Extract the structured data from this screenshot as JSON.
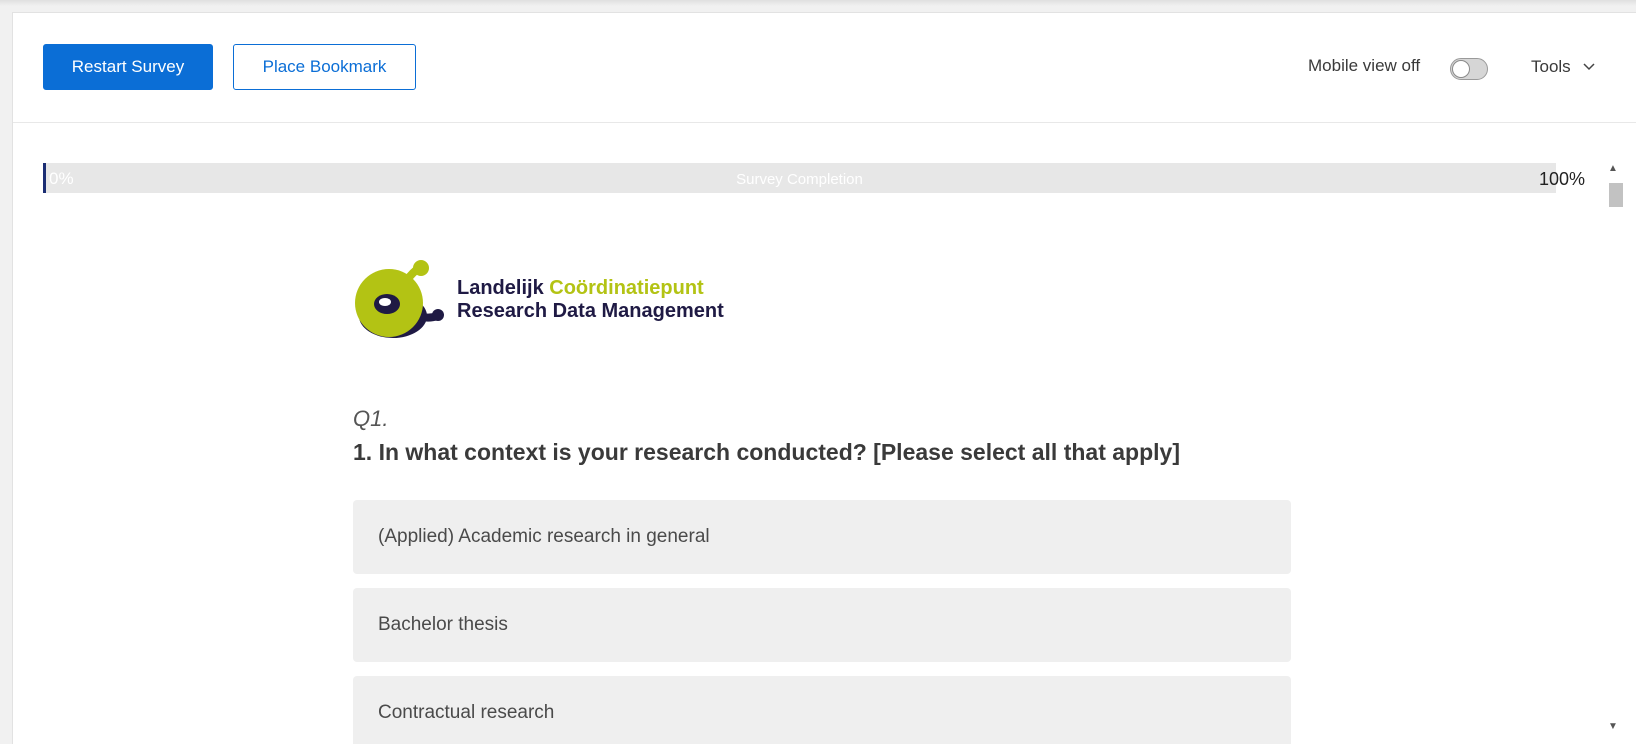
{
  "toolbar": {
    "restart_label": "Restart Survey",
    "bookmark_label": "Place Bookmark",
    "mobile_label": "Mobile view off",
    "mobile_on": false,
    "tools_label": "Tools"
  },
  "progress": {
    "start_label": "0%",
    "center_label": "Survey Completion",
    "end_label": "100%",
    "value_percent": 0
  },
  "logo": {
    "line1_a": "Landelijk",
    "line1_b": "Coördinatiepunt",
    "line2": "Research Data Management"
  },
  "question": {
    "number": "Q1.",
    "text": "1. In what context is your research conducted? [Please select all that apply]",
    "options": [
      "(Applied) Academic research in general",
      "Bachelor thesis",
      "Contractual research"
    ]
  },
  "colors": {
    "primary": "#0b6ed6",
    "progress_fill": "#1b2d73",
    "logo_green": "#b3c314",
    "logo_navy": "#1f1a44"
  }
}
